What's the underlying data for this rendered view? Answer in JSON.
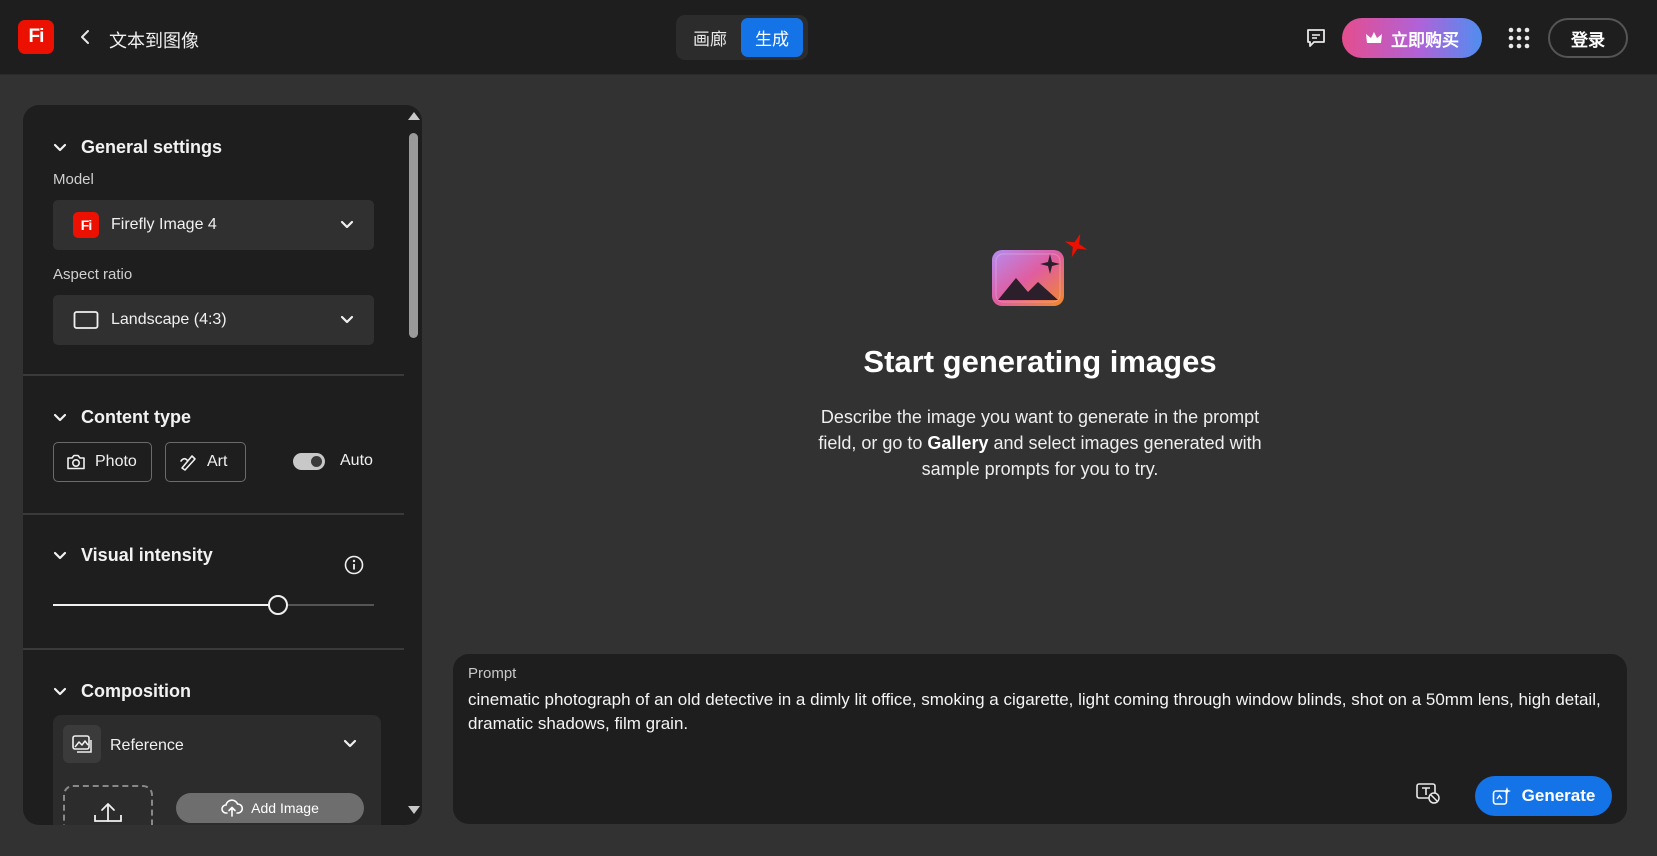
{
  "header": {
    "logo_text": "Fi",
    "page_title": "文本到图像",
    "modes": [
      {
        "label": "画廊",
        "active": false
      },
      {
        "label": "生成",
        "active": true
      }
    ],
    "buy_label": "立即购买",
    "signin_label": "登录"
  },
  "sidebar": {
    "general": {
      "title": "General settings",
      "model_label": "Model",
      "model_value": "Firefly Image 4",
      "model_badge": "Fi",
      "aspect_label": "Aspect ratio",
      "aspect_value": "Landscape (4:3)"
    },
    "content_type": {
      "title": "Content type",
      "photo_label": "Photo",
      "art_label": "Art",
      "auto_label": "Auto",
      "auto_on": true
    },
    "visual_intensity": {
      "title": "Visual intensity",
      "value_fraction": 0.7
    },
    "composition": {
      "title": "Composition",
      "reference_label": "Reference",
      "add_image_label": "Add Image"
    }
  },
  "empty_state": {
    "title": "Start generating images",
    "text_before": "Describe the image you want to generate in the prompt field, or go to ",
    "text_bold": "Gallery",
    "text_after": " and select images generated with sample prompts for you to try."
  },
  "prompt": {
    "label": "Prompt",
    "value": "cinematic photograph of an old detective in a dimly lit office, smoking a cigarette, light coming through window blinds, shot on a 50mm lens, high detail, dramatic shadows, film grain.",
    "generate_label": "Generate"
  },
  "colors": {
    "accent": "#1473e6",
    "brand_red": "#eb1000",
    "background": "#323232",
    "panel": "#1e1e1e"
  }
}
